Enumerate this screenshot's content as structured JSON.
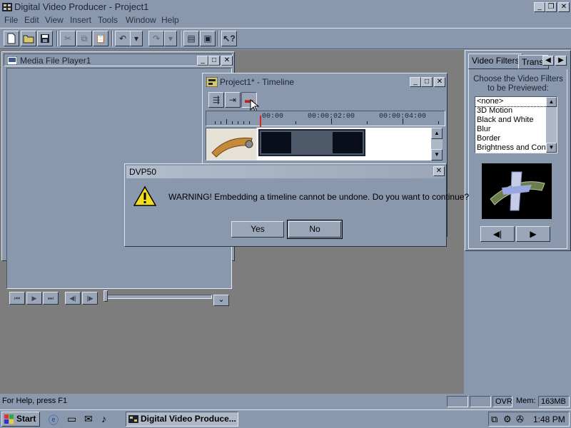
{
  "app": {
    "title": "Digital Video Producer - Project1",
    "minimize": "_",
    "restore": "❐",
    "close": "✕"
  },
  "menu": [
    "File",
    "Edit",
    "View",
    "Insert",
    "Tools",
    "Window",
    "Help"
  ],
  "toolbar": {
    "icons": [
      "new-file-icon",
      "open-folder-icon",
      "save-icon",
      "cut-icon",
      "copy-icon",
      "paste-icon",
      "undo-icon",
      "redo-icon",
      "undo-disabled-icon",
      "redo-disabled-icon",
      "storyboard-icon",
      "capture-icon",
      "help-pointer-icon"
    ]
  },
  "media_player": {
    "title": "Media File Player1",
    "minimize": "_",
    "maximize": "□",
    "close": "✕",
    "controls": [
      "⏮",
      "▶",
      "⏭",
      "◀|",
      "|▶"
    ],
    "dropdown": "⌄"
  },
  "timeline": {
    "title": "Project1* - Timeline",
    "minimize": "_",
    "maximize": "□",
    "close": "✕",
    "ruler_labels": [
      "00:00",
      "00:00:02:00",
      "00:00:04:00"
    ]
  },
  "right_panel": {
    "tabs": [
      "Video Filters",
      "Transi"
    ],
    "caption": "Choose the Video Filters to be Previewed:",
    "filters": [
      "<none>",
      "3D Motion",
      "Black and White",
      "Blur",
      "Border",
      "Brightness and Contr"
    ],
    "prev_label": "◀|",
    "next_label": "▶"
  },
  "dialog": {
    "title": "DVP50",
    "close": "✕",
    "message": "WARNING! Embedding a timeline cannot be undone. Do you want to continue?",
    "yes": "Yes",
    "no": "No"
  },
  "status": {
    "help": "For Help, press F1",
    "ovr": "OVR",
    "mem": "Mem:",
    "mem_value": "163MB"
  },
  "taskbar": {
    "start": "Start",
    "task": "Digital Video Produce...",
    "time": "1:48 PM"
  }
}
